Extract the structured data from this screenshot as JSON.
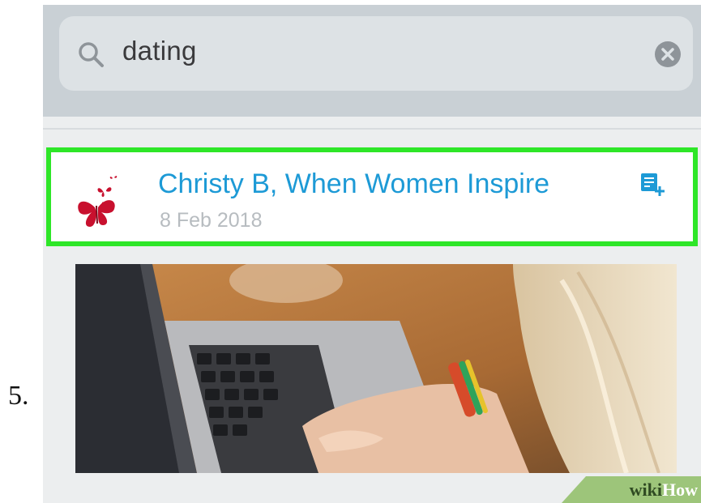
{
  "step": {
    "number": "5."
  },
  "search": {
    "query": "dating"
  },
  "result": {
    "title": "Christy B, When Women Inspire",
    "date": "8 Feb 2018",
    "highlight_color": "#2ee628",
    "title_color": "#1d9ad6"
  },
  "icons": {
    "search": "search-icon",
    "clear": "clear-icon",
    "logo": "butterflies-logo",
    "action": "add-to-reading-list-icon"
  },
  "watermark": {
    "part1": "wiki",
    "part2": "How"
  }
}
